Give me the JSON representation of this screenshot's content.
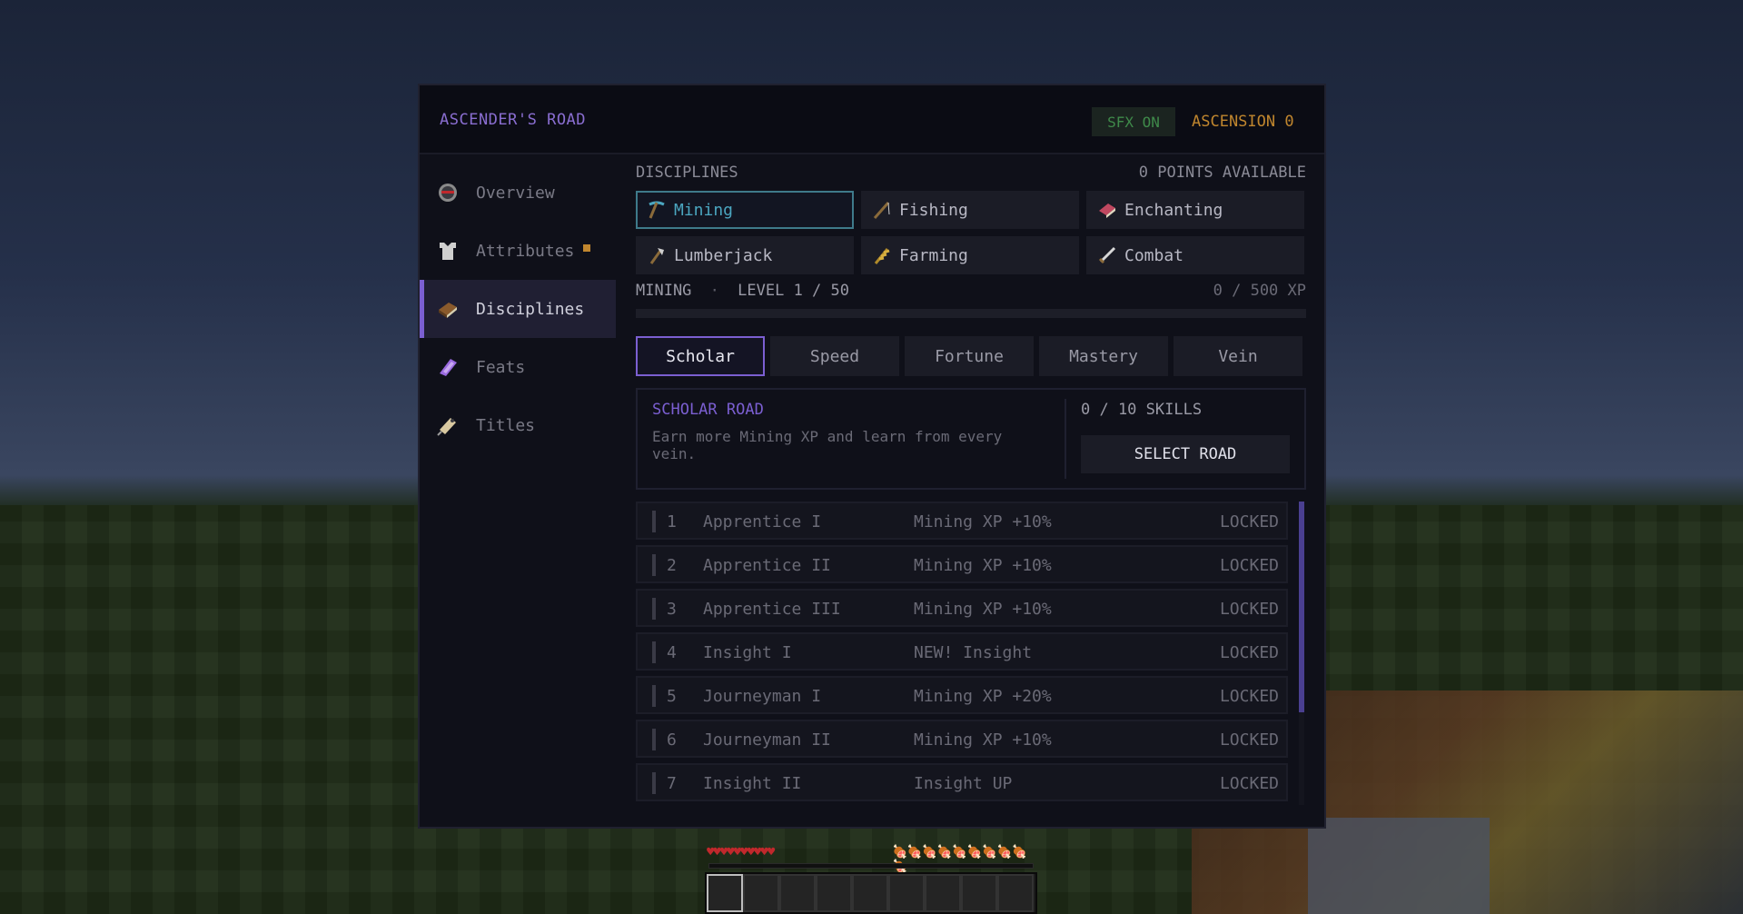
{
  "header": {
    "title": "ASCENDER'S ROAD",
    "sfx": "SFX ON",
    "ascension": "ASCENSION 0"
  },
  "sidebar": {
    "items": [
      {
        "label": "Overview",
        "icon": "compass-icon"
      },
      {
        "label": "Attributes",
        "icon": "chestplate-icon",
        "has_dot": true
      },
      {
        "label": "Disciplines",
        "icon": "book-icon",
        "active": true
      },
      {
        "label": "Feats",
        "icon": "amethyst-icon"
      },
      {
        "label": "Titles",
        "icon": "name-tag-icon"
      }
    ]
  },
  "disciplines": {
    "heading": "DISCIPLINES",
    "points": "0 POINTS AVAILABLE",
    "items": [
      {
        "label": "Mining",
        "icon": "pickaxe-icon",
        "active": true
      },
      {
        "label": "Fishing",
        "icon": "fishing-rod-icon"
      },
      {
        "label": "Enchanting",
        "icon": "enchanted-book-icon"
      },
      {
        "label": "Lumberjack",
        "icon": "axe-icon"
      },
      {
        "label": "Farming",
        "icon": "wheat-icon"
      },
      {
        "label": "Combat",
        "icon": "sword-icon"
      }
    ]
  },
  "progress": {
    "discipline": "MINING",
    "separator": "·",
    "level": "LEVEL 1 / 50",
    "xp": "0 / 500 XP",
    "fraction": 0
  },
  "roads": {
    "tabs": [
      "Scholar",
      "Speed",
      "Fortune",
      "Mastery",
      "Vein"
    ],
    "active_index": 0
  },
  "road_detail": {
    "name": "SCHOLAR ROAD",
    "description": "Earn more Mining XP and learn from every vein.",
    "skills": "0 / 10  SKILLS",
    "select_label": "SELECT ROAD"
  },
  "skills": [
    {
      "num": "1",
      "name": "Apprentice I",
      "effect": "Mining XP +10%",
      "status": "LOCKED"
    },
    {
      "num": "2",
      "name": "Apprentice II",
      "effect": "Mining XP +10%",
      "status": "LOCKED"
    },
    {
      "num": "3",
      "name": "Apprentice III",
      "effect": "Mining XP +10%",
      "status": "LOCKED"
    },
    {
      "num": "4",
      "name": "Insight I",
      "effect": "NEW! Insight",
      "status": "LOCKED"
    },
    {
      "num": "5",
      "name": "Journeyman I",
      "effect": "Mining XP +20%",
      "status": "LOCKED"
    },
    {
      "num": "6",
      "name": "Journeyman II",
      "effect": "Mining XP +10%",
      "status": "LOCKED"
    },
    {
      "num": "7",
      "name": "Insight II",
      "effect": "Insight UP",
      "status": "LOCKED"
    }
  ],
  "hud": {
    "hearts": "♥♥♥♥♥♥♥♥♥♥",
    "hunger": "🍖🍖🍖🍖🍖🍖🍖🍖🍖🍖",
    "hotbar_slots": 9,
    "selected_slot": 0
  },
  "colors": {
    "accent": "#7b5fd1",
    "mining_active": "#4ba6c0",
    "ascension": "#c0862e",
    "sfx": "#3f8a4a"
  }
}
